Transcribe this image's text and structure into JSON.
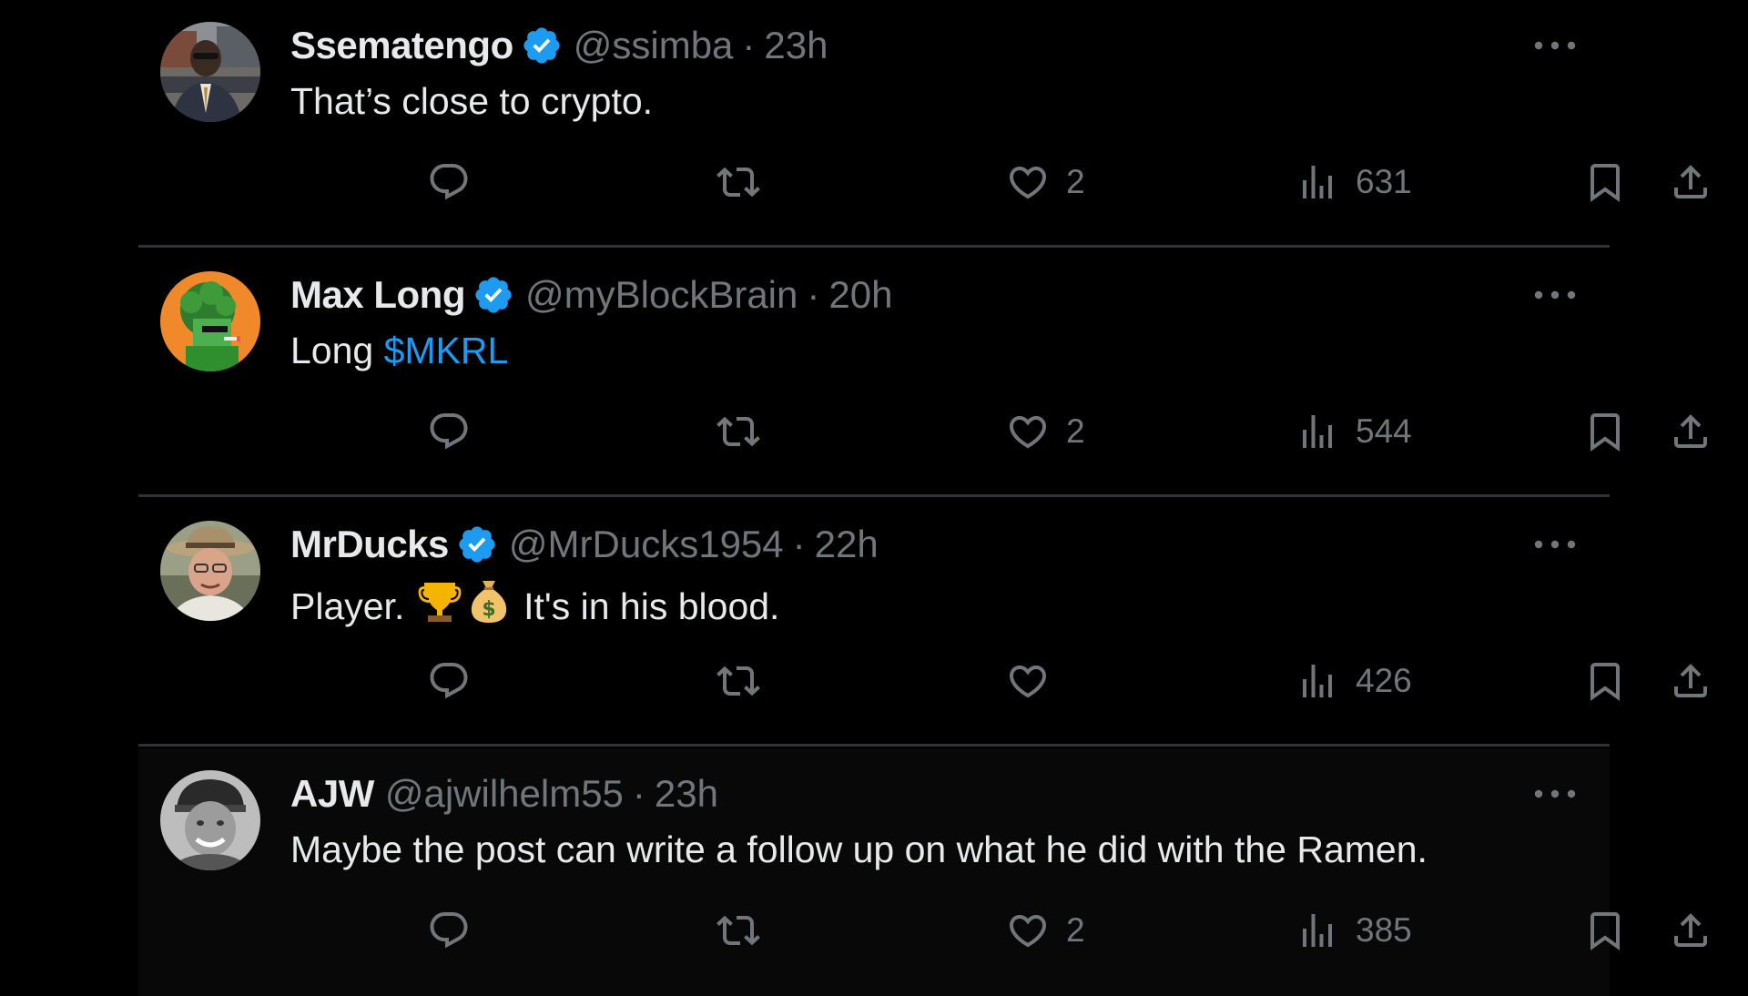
{
  "colors": {
    "background": "#000000",
    "text_primary": "#e7e9ea",
    "text_secondary": "#71767b",
    "accent": "#1d9bf0",
    "divider": "#2f3336"
  },
  "icons": [
    "verified-badge-icon",
    "more-icon",
    "reply-icon",
    "retweet-icon",
    "like-icon",
    "views-icon",
    "bookmark-icon",
    "share-icon",
    "trophy-emoji",
    "money-bag-emoji"
  ],
  "tweets": [
    {
      "name": "Ssematengo",
      "verified": true,
      "handle": "@ssimba",
      "separator": "·",
      "time": "23h",
      "text": "That’s close to crypto.",
      "likes": "2",
      "views": "631"
    },
    {
      "name": "Max Long",
      "verified": true,
      "handle": "@myBlockBrain",
      "separator": "·",
      "time": "20h",
      "text_prefix": "Long ",
      "cashtag": "$MKRL",
      "likes": "2",
      "views": "544"
    },
    {
      "name": "MrDucks",
      "verified": true,
      "handle": "@MrDucks1954",
      "separator": "·",
      "time": "22h",
      "text_prefix": "Player. ",
      "text_suffix": " It's in his blood.",
      "likes": "",
      "views": "426"
    },
    {
      "name": "AJW",
      "verified": false,
      "handle": "@ajwilhelm55",
      "separator": "·",
      "time": "23h",
      "text": "Maybe the post can write a follow up on what he did with the Ramen.",
      "likes": "2",
      "views": "385"
    }
  ]
}
